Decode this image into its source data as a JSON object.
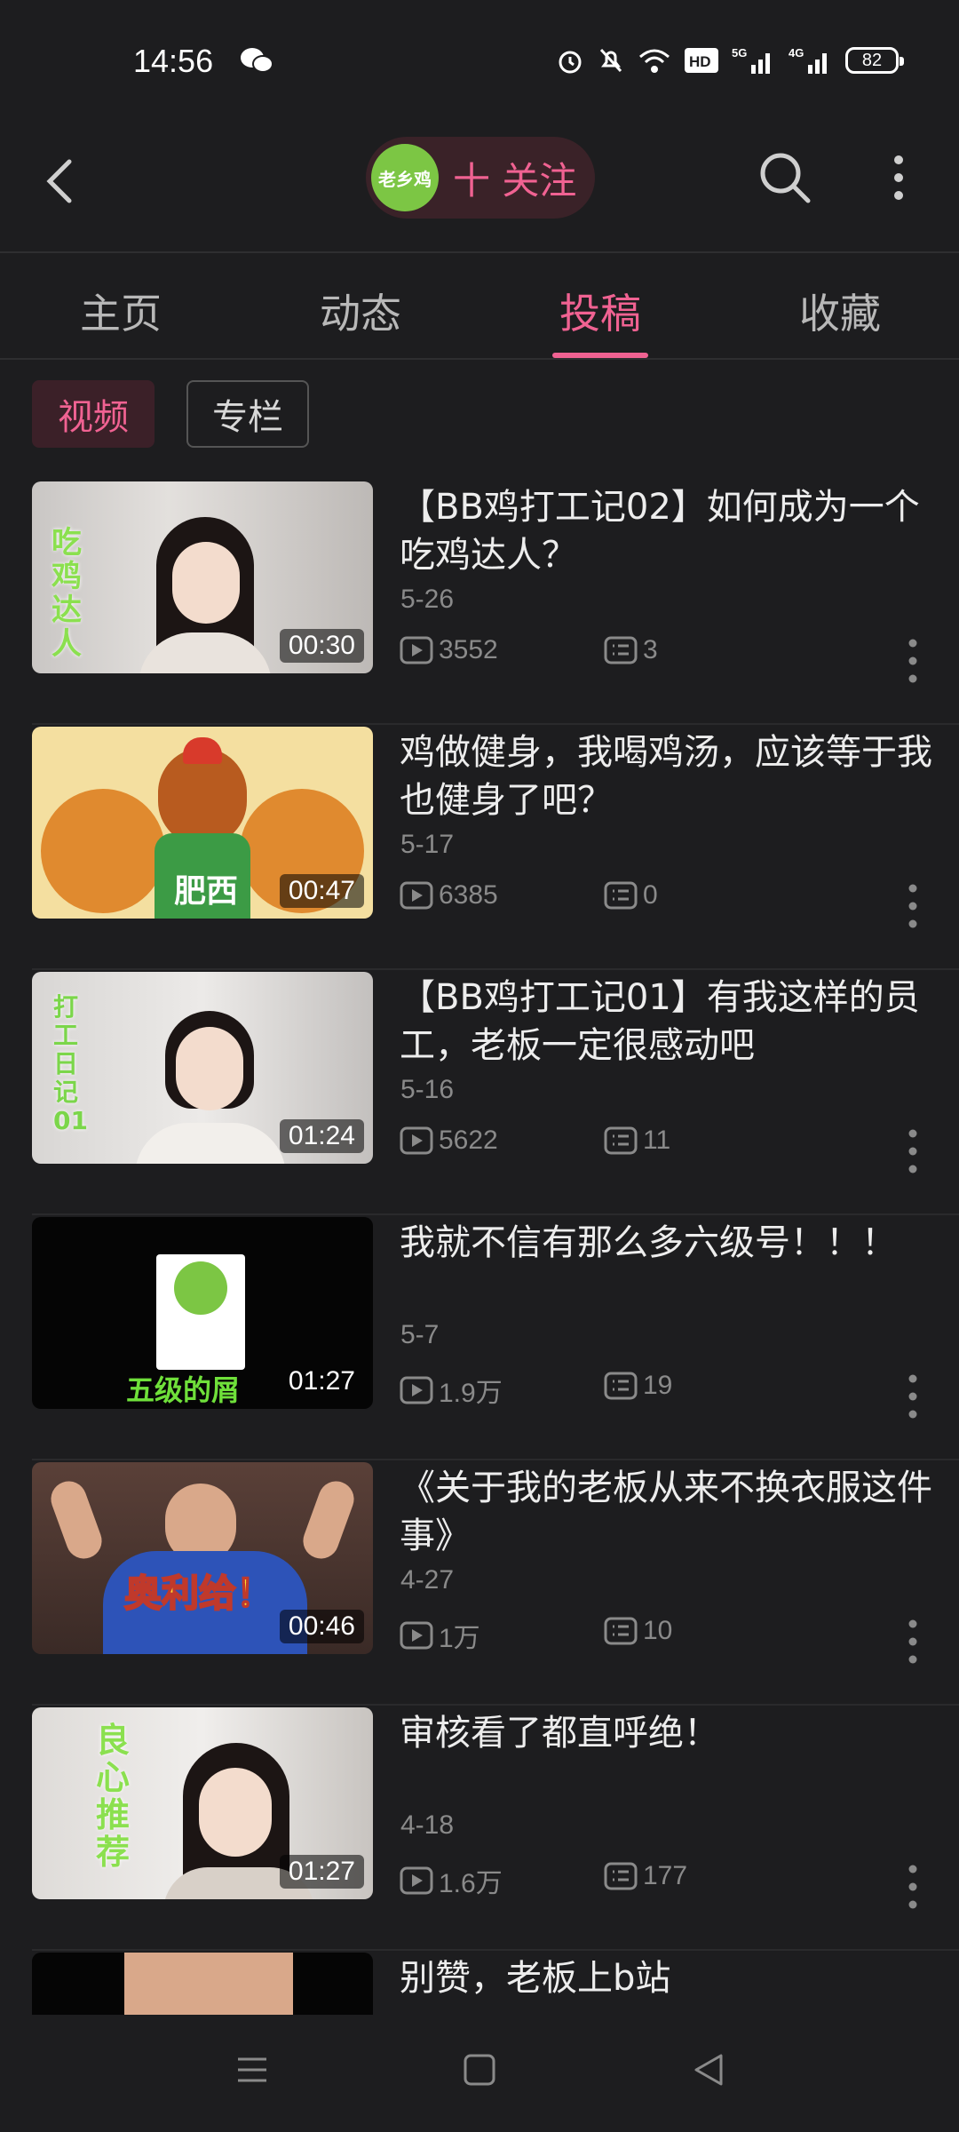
{
  "status_bar": {
    "time": "14:56",
    "battery": "82",
    "icons": [
      "wechat-icon",
      "alarm-icon",
      "mute-icon",
      "wifi-icon",
      "hd-icon",
      "5g-signal-icon",
      "4g-signal-icon",
      "battery-icon"
    ]
  },
  "header": {
    "brand_avatar_text": "老乡鸡",
    "follow_label": "十 关注",
    "accent_color": "#f06292"
  },
  "tabs": [
    {
      "label": "主页",
      "active": false
    },
    {
      "label": "动态",
      "active": false
    },
    {
      "label": "投稿",
      "active": true
    },
    {
      "label": "收藏",
      "active": false
    }
  ],
  "filters": {
    "video": "视频",
    "column": "专栏"
  },
  "videos": [
    {
      "title": "【BB鸡打工记02】如何成为一个吃鸡达人？",
      "date": "5-26",
      "plays": "3552",
      "comments": "3",
      "duration": "00:30",
      "thumb_text": "吃鸡达人"
    },
    {
      "title": "鸡做健身，我喝鸡汤，应该等于我也健身了吧？",
      "date": "5-17",
      "plays": "6385",
      "comments": "0",
      "duration": "00:47",
      "thumb_text": "肥西"
    },
    {
      "title": "【BB鸡打工记01】有我这样的员工，老板一定很感动吧",
      "date": "5-16",
      "plays": "5622",
      "comments": "11",
      "duration": "01:24",
      "thumb_text": "打工日记01"
    },
    {
      "title": "我就不信有那么多六级号！！！",
      "date": "5-7",
      "plays": "1.9万",
      "comments": "19",
      "duration": "01:27",
      "thumb_text": "五级的屑"
    },
    {
      "title": "《关于我的老板从来不换衣服这件事》",
      "date": "4-27",
      "plays": "1万",
      "comments": "10",
      "duration": "00:46",
      "thumb_text": "奥利给！"
    },
    {
      "title": "审核看了都直呼绝！",
      "date": "4-18",
      "plays": "1.6万",
      "comments": "177",
      "duration": "01:27",
      "thumb_text": "良心推荐"
    },
    {
      "title": "别赞，老板上b站",
      "date": "",
      "plays": "",
      "comments": "",
      "duration": "",
      "thumb_text": ""
    }
  ]
}
